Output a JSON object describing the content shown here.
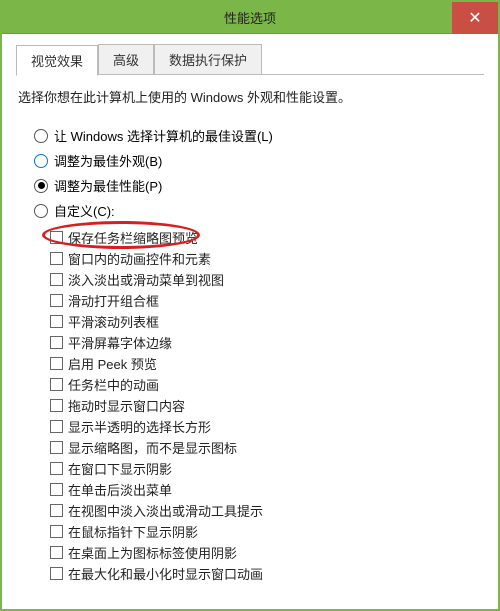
{
  "window": {
    "title": "性能选项",
    "close": "✕"
  },
  "tabs": [
    {
      "label": "视觉效果",
      "active": true
    },
    {
      "label": "高级",
      "active": false
    },
    {
      "label": "数据执行保护",
      "active": false
    }
  ],
  "description": "选择你想在此计算机上使用的 Windows 外观和性能设置。",
  "radios": [
    {
      "label": "让 Windows 选择计算机的最佳设置(L)",
      "selected": false,
      "blue": false
    },
    {
      "label": "调整为最佳外观(B)",
      "selected": false,
      "blue": true
    },
    {
      "label": "调整为最佳性能(P)",
      "selected": true,
      "blue": false
    },
    {
      "label": "自定义(C):",
      "selected": false,
      "blue": false
    }
  ],
  "checks": [
    "保存任务栏缩略图预览",
    "窗口内的动画控件和元素",
    "淡入淡出或滑动菜单到视图",
    "滑动打开组合框",
    "平滑滚动列表框",
    "平滑屏幕字体边缘",
    "启用 Peek 预览",
    "任务栏中的动画",
    "拖动时显示窗口内容",
    "显示半透明的选择长方形",
    "显示缩略图，而不是显示图标",
    "在窗口下显示阴影",
    "在单击后淡出菜单",
    "在视图中淡入淡出或滑动工具提示",
    "在鼠标指针下显示阴影",
    "在桌面上为图标标签使用阴影",
    "在最大化和最小化时显示窗口动画"
  ]
}
